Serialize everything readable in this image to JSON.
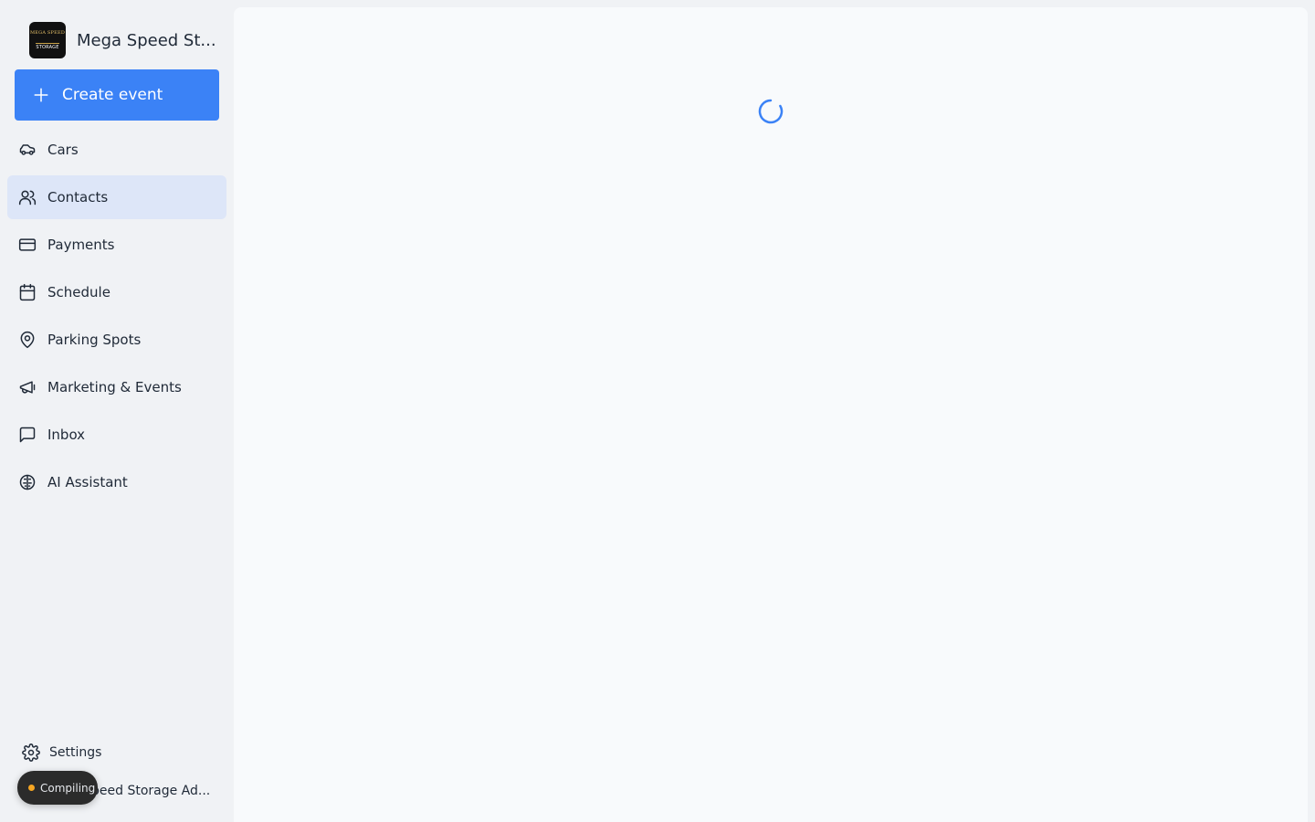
{
  "brand": {
    "name": "Mega Speed St...",
    "logo_text_top": "MEGA SPEED",
    "logo_text_bottom": "STORAGE"
  },
  "create_button": {
    "label": "Create event",
    "color": "#3b82f6"
  },
  "nav": {
    "items": [
      {
        "label": "Cars",
        "icon": "car-icon",
        "active": false
      },
      {
        "label": "Contacts",
        "icon": "users-icon",
        "active": true
      },
      {
        "label": "Payments",
        "icon": "credit-card-icon",
        "active": false
      },
      {
        "label": "Schedule",
        "icon": "calendar-icon",
        "active": false
      },
      {
        "label": "Parking Spots",
        "icon": "map-pin-icon",
        "active": false
      },
      {
        "label": "Marketing & Events",
        "icon": "megaphone-icon",
        "active": false
      },
      {
        "label": "Inbox",
        "icon": "message-square-icon",
        "active": false
      },
      {
        "label": "AI Assistant",
        "icon": "brain-icon",
        "active": false
      }
    ],
    "active_bg": "#dde6f8"
  },
  "footer": {
    "settings_label": "Settings",
    "user_name": "peed Storage Ad...",
    "compiling_label": "Compiling"
  },
  "main": {
    "loading": true,
    "spinner_color": "#3b82f6"
  }
}
